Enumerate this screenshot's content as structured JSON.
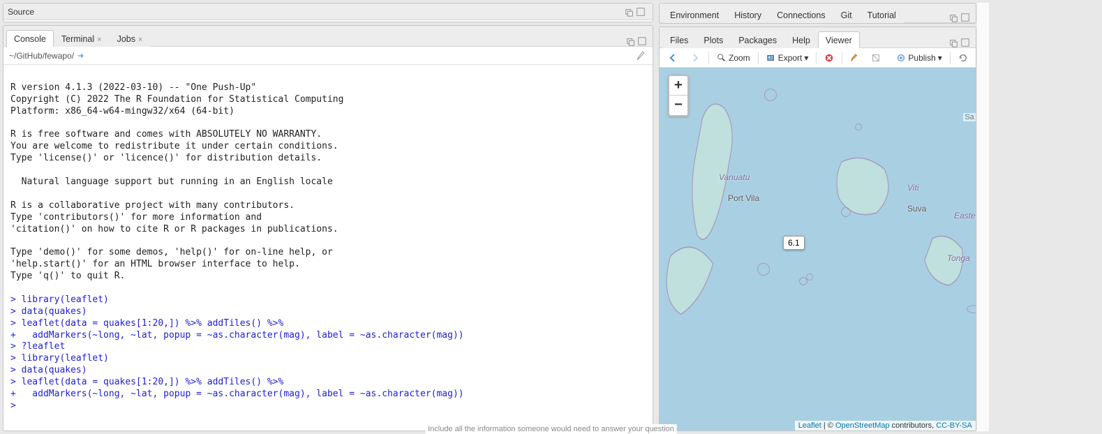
{
  "left": {
    "source_title": "Source",
    "tabs": {
      "console": "Console",
      "terminal": "Terminal",
      "jobs": "Jobs"
    },
    "breadcrumb": "~/GitHub/fewapo/",
    "console_output": [
      {
        "t": "",
        "cls": ""
      },
      {
        "t": "R version 4.1.3 (2022-03-10) -- \"One Push-Up\"",
        "cls": ""
      },
      {
        "t": "Copyright (C) 2022 The R Foundation for Statistical Computing",
        "cls": ""
      },
      {
        "t": "Platform: x86_64-w64-mingw32/x64 (64-bit)",
        "cls": ""
      },
      {
        "t": "",
        "cls": ""
      },
      {
        "t": "R is free software and comes with ABSOLUTELY NO WARRANTY.",
        "cls": ""
      },
      {
        "t": "You are welcome to redistribute it under certain conditions.",
        "cls": ""
      },
      {
        "t": "Type 'license()' or 'licence()' for distribution details.",
        "cls": ""
      },
      {
        "t": "",
        "cls": ""
      },
      {
        "t": "  Natural language support but running in an English locale",
        "cls": ""
      },
      {
        "t": "",
        "cls": ""
      },
      {
        "t": "R is a collaborative project with many contributors.",
        "cls": ""
      },
      {
        "t": "Type 'contributors()' for more information and",
        "cls": ""
      },
      {
        "t": "'citation()' on how to cite R or R packages in publications.",
        "cls": ""
      },
      {
        "t": "",
        "cls": ""
      },
      {
        "t": "Type 'demo()' for some demos, 'help()' for on-line help, or",
        "cls": ""
      },
      {
        "t": "'help.start()' for an HTML browser interface to help.",
        "cls": ""
      },
      {
        "t": "Type 'q()' to quit R.",
        "cls": ""
      },
      {
        "t": "",
        "cls": ""
      },
      {
        "t": "> library(leaflet)",
        "cls": "code"
      },
      {
        "t": "> data(quakes)",
        "cls": "code"
      },
      {
        "t": "> leaflet(data = quakes[1:20,]) %>% addTiles() %>%",
        "cls": "code"
      },
      {
        "t": "+   addMarkers(~long, ~lat, popup = ~as.character(mag), label = ~as.character(mag))",
        "cls": "code"
      },
      {
        "t": "> ?leaflet",
        "cls": "code"
      },
      {
        "t": "> library(leaflet)",
        "cls": "code"
      },
      {
        "t": "> data(quakes)",
        "cls": "code"
      },
      {
        "t": "> leaflet(data = quakes[1:20,]) %>% addTiles() %>%",
        "cls": "code"
      },
      {
        "t": "+   addMarkers(~long, ~lat, popup = ~as.character(mag), label = ~as.character(mag))",
        "cls": "code"
      },
      {
        "t": "> ",
        "cls": "code"
      }
    ]
  },
  "right": {
    "top_tabs": [
      "Environment",
      "History",
      "Connections",
      "Git",
      "Tutorial"
    ],
    "bottom_tabs": [
      "Files",
      "Plots",
      "Packages",
      "Help",
      "Viewer"
    ],
    "active_bottom": "Viewer",
    "toolbar": {
      "zoom": "Zoom",
      "export": "Export",
      "publish": "Publish"
    },
    "map": {
      "tooltip_value": "6.1",
      "labels": {
        "vanuatu": "Vanuatu",
        "port_vila": "Port Vila",
        "viti": "Viti",
        "suva": "Suva",
        "eastern": "Eastern",
        "tonga": "Tonga",
        "sa": "Sa"
      },
      "attribution": {
        "leaflet": "Leaflet",
        "sep": " | © ",
        "osm": "OpenStreetMap",
        "contrib": " contributors, ",
        "cc": "CC-BY-SA"
      }
    }
  },
  "footer_hint": "Include all the information someone would need to answer your question"
}
